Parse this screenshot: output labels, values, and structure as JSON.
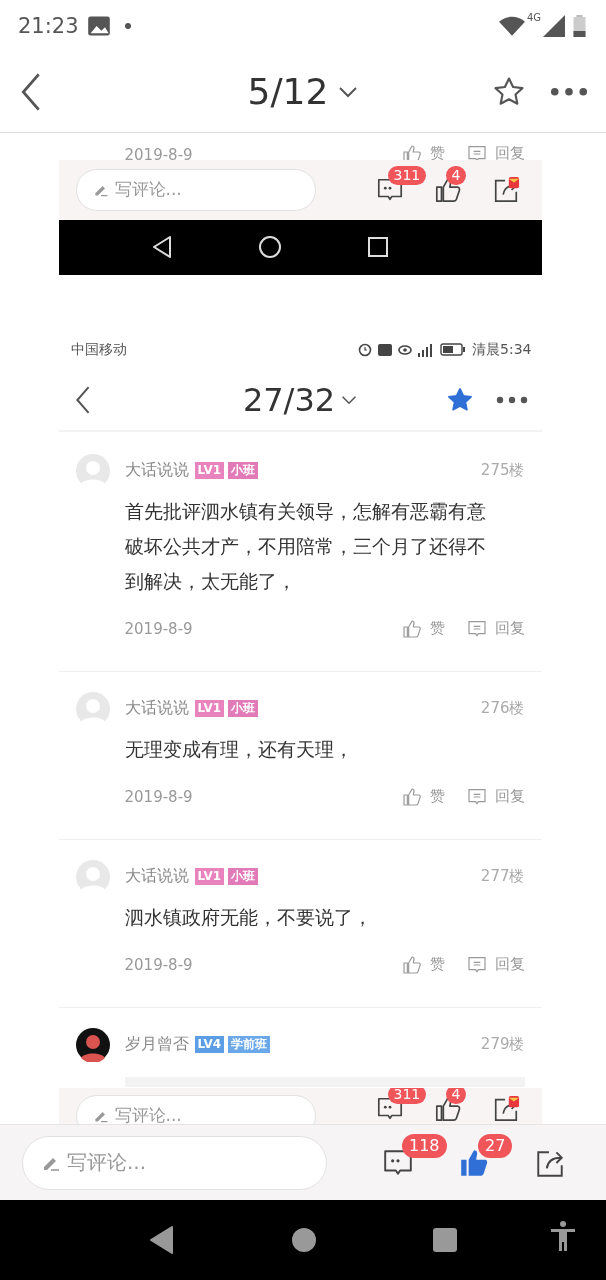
{
  "status_bar": {
    "time": "21:23",
    "network": "4G"
  },
  "top_bar": {
    "title": "5/12",
    "favorited": false
  },
  "image_top": {
    "row": {
      "date": "2019-8-9",
      "like": "赞",
      "reply": "回复"
    },
    "comment_bar": {
      "placeholder": "写评论...",
      "comments": "311",
      "likes": "4",
      "liked": false
    }
  },
  "image_main": {
    "status_bar": {
      "carrier": "中国移动",
      "time": "清晨5:34"
    },
    "top_bar": {
      "title": "27/32",
      "favorited": true
    },
    "comments": [
      {
        "user": "大话说说",
        "kind": "light",
        "badges": [
          {
            "text": "LV1",
            "color": "#e883bd"
          },
          {
            "text": "小班",
            "color": "#e27ab8"
          }
        ],
        "floor": "275楼",
        "text": "首先批评泗水镇有关领导，怎解有恶霸有意破坏公共才产，不用陪常，三个月了还得不到解决，太无能了，",
        "date": "2019-8-9",
        "like": "赞",
        "reply": "回复"
      },
      {
        "user": "大话说说",
        "kind": "light",
        "badges": [
          {
            "text": "LV1",
            "color": "#e883bd"
          },
          {
            "text": "小班",
            "color": "#e27ab8"
          }
        ],
        "floor": "276楼",
        "text": "无理变成有理，还有天理，",
        "date": "2019-8-9",
        "like": "赞",
        "reply": "回复"
      },
      {
        "user": "大话说说",
        "kind": "light",
        "badges": [
          {
            "text": "LV1",
            "color": "#e883bd"
          },
          {
            "text": "小班",
            "color": "#e27ab8"
          }
        ],
        "floor": "277楼",
        "text": "泗水镇政府无能，不要说了，",
        "date": "2019-8-9",
        "like": "赞",
        "reply": "回复"
      },
      {
        "user": "岁月曾否",
        "kind": "dark",
        "badges": [
          {
            "text": "LV4",
            "color": "#5b9ee6"
          },
          {
            "text": "学前班",
            "color": "#6aa8ea"
          }
        ],
        "floor": "279楼"
      }
    ],
    "comment_bar": {
      "placeholder": "写评论...",
      "comments": "311",
      "likes": "4",
      "liked": false
    }
  },
  "bottom_bar": {
    "placeholder": "写评论...",
    "comments": "118",
    "likes": "27",
    "liked": true
  }
}
